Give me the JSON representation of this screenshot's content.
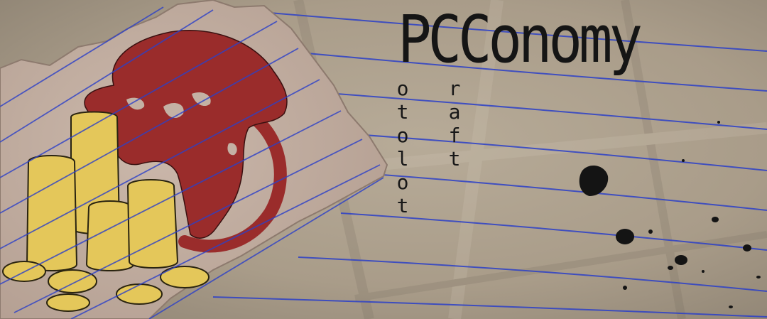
{
  "banner": {
    "title": "PCConomy",
    "vertical_words": [
      {
        "text": "otolot"
      },
      {
        "text": "raft"
      }
    ]
  },
  "colors": {
    "paper": "#b3a694",
    "torn_paper": "#c4b1a4",
    "rule_line": "#2c40c8",
    "globe": "#9a2c2b",
    "coins": "#e4c75a",
    "ink": "#151515"
  },
  "icons": [
    "globe-icon",
    "coin-stack-icon",
    "ink-splatter"
  ]
}
